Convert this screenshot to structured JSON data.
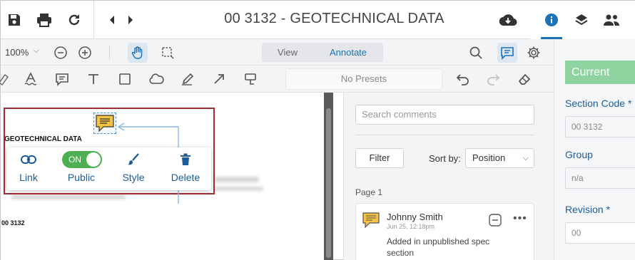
{
  "app": {
    "document_title": "00 3132 - GEOTECHNICAL DATA"
  },
  "toolbar": {
    "zoom": "100%",
    "mode_view": "View",
    "mode_annotate": "Annotate",
    "presets": "No Presets"
  },
  "document": {
    "heading": "GEOTECHNICAL DATA",
    "section_code": "00 3132"
  },
  "popover": {
    "link_label": "Link",
    "public_label": "Public",
    "public_toggle": "ON",
    "style_label": "Style",
    "delete_label": "Delete"
  },
  "comments": {
    "search_placeholder": "Search comments",
    "filter_label": "Filter",
    "sort_label": "Sort by:",
    "sort_value": "Position",
    "page_label": "Page 1",
    "items": [
      {
        "author": "Johnny Smith",
        "date": "Jun 25, 12:18pm",
        "text": "Added in unpublished spec section"
      }
    ]
  },
  "properties": {
    "status": "Current",
    "section_code_label": "Section Code *",
    "section_code_value": "00 3132",
    "group_label": "Group",
    "group_value": "n/a",
    "revision_label": "Revision *",
    "revision_value": "00"
  },
  "colors": {
    "accent": "#1a73b8",
    "selection_border": "#a32b35",
    "toggle_on": "#4caf50",
    "status_current": "#8fd4a0",
    "note_yellow": "#f5c242"
  }
}
